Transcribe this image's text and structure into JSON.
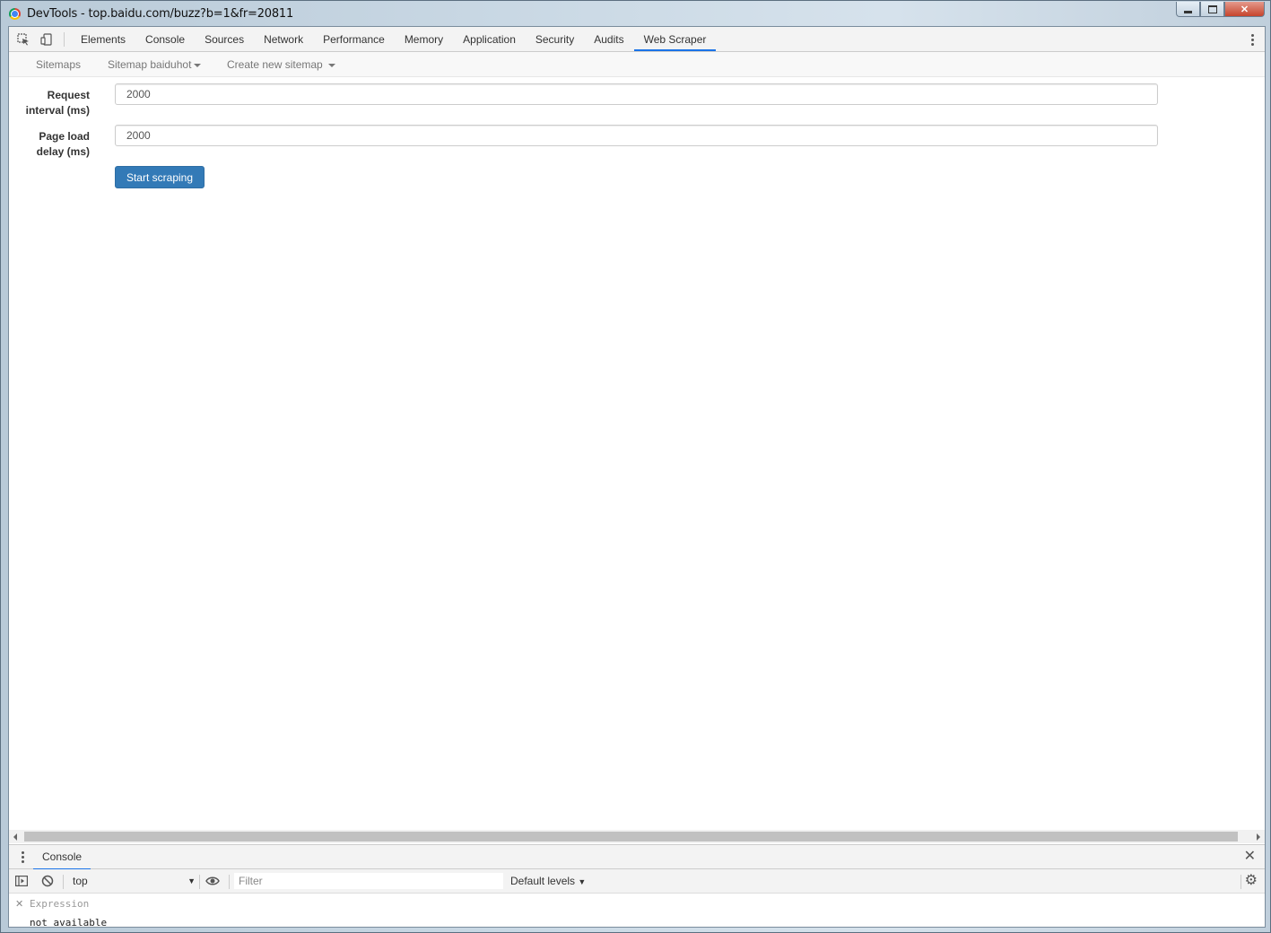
{
  "window": {
    "title": "DevTools - top.baidu.com/buzz?b=1&fr=20811"
  },
  "devtools": {
    "tabs": [
      {
        "label": "Elements"
      },
      {
        "label": "Console"
      },
      {
        "label": "Sources"
      },
      {
        "label": "Network"
      },
      {
        "label": "Performance"
      },
      {
        "label": "Memory"
      },
      {
        "label": "Application"
      },
      {
        "label": "Security"
      },
      {
        "label": "Audits"
      },
      {
        "label": "Web Scraper",
        "active": true
      }
    ]
  },
  "scraper": {
    "nav": {
      "sitemaps": "Sitemaps",
      "sitemap_current": "Sitemap baiduhot",
      "create_new": "Create new sitemap"
    },
    "form": {
      "request_interval_label_1": "Request",
      "request_interval_label_2": "interval (ms)",
      "request_interval_value": "2000",
      "page_load_label_1": "Page load",
      "page_load_label_2": "delay (ms)",
      "page_load_value": "2000",
      "start_button": "Start scraping"
    }
  },
  "drawer": {
    "tab": "Console",
    "context": "top",
    "filter_placeholder": "Filter",
    "levels": "Default levels",
    "watch_expression_placeholder": "Expression",
    "watch_value": "not available"
  },
  "colors": {
    "accent": "#1a73e8",
    "primary_button": "#337ab7"
  }
}
